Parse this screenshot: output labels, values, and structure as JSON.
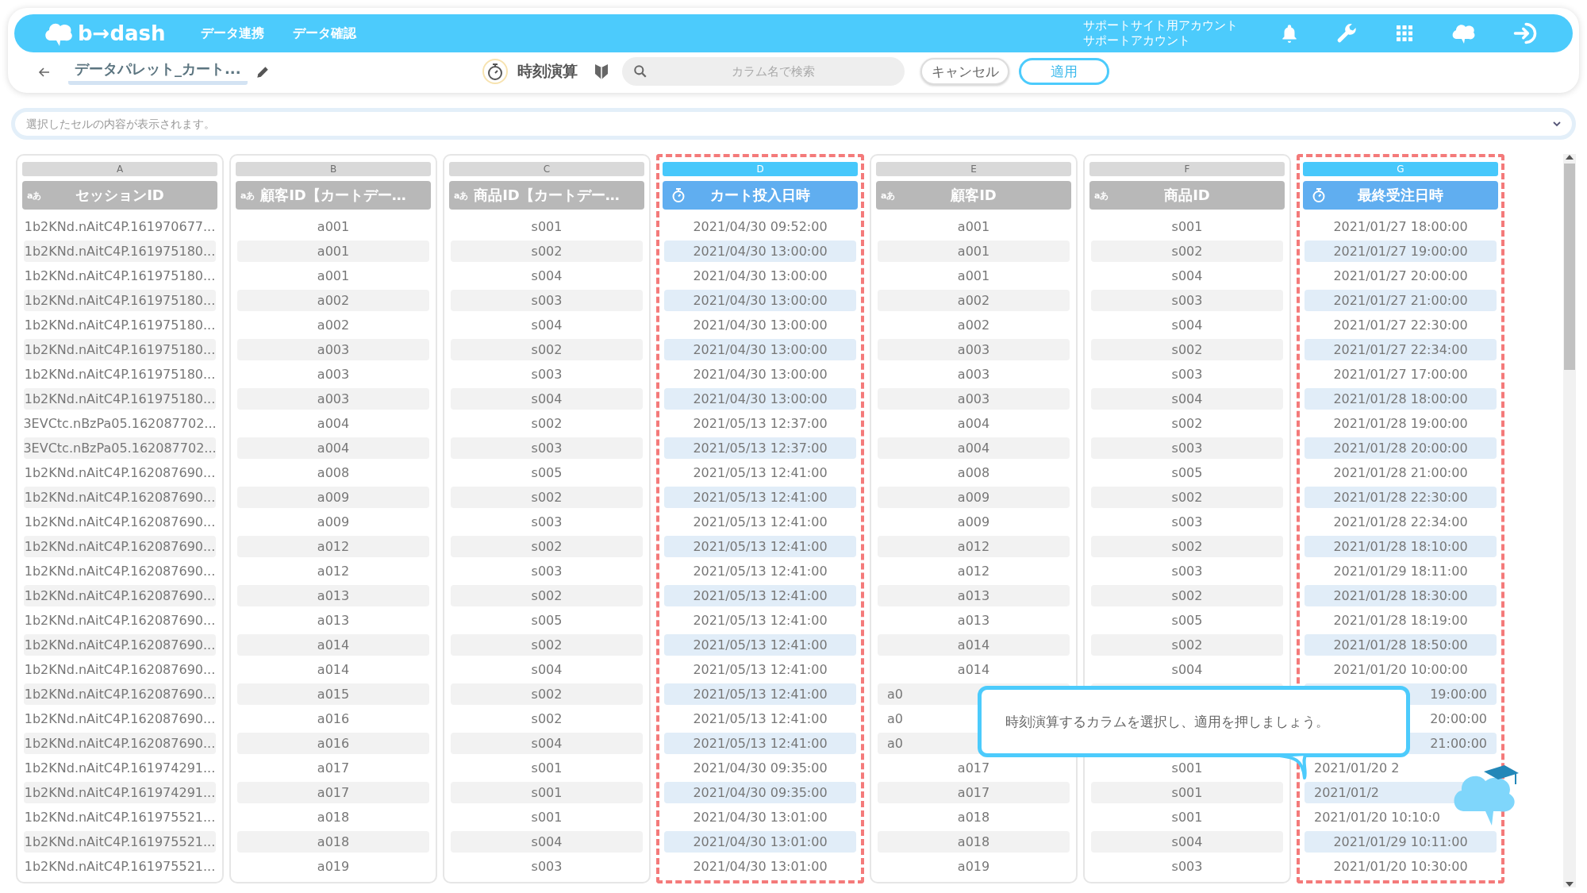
{
  "header": {
    "logo": "b→dash",
    "nav": [
      {
        "label": "データ連携"
      },
      {
        "label": "データ確認"
      }
    ],
    "account": [
      "サポートサイト用アカウント",
      "サポートアカウント"
    ]
  },
  "toolbar": {
    "title": "データパレット_カート...",
    "mode_label": "時刻演算",
    "search": {
      "placeholder": "カラム名で検索"
    },
    "buttons": [
      {
        "label": "キャンセル",
        "kind": "secondary"
      },
      {
        "label": "適用",
        "kind": "primary"
      }
    ]
  },
  "cell_viewer": {
    "placeholder": "選択したセルの内容が表示されます。"
  },
  "columns": [
    {
      "letter": "A",
      "name": "セッションID",
      "kind": "text",
      "type_label": "aあ",
      "selected": false
    },
    {
      "letter": "B",
      "name": "顧客ID【カートデー…",
      "kind": "text",
      "type_label": "aあ",
      "selected": false
    },
    {
      "letter": "C",
      "name": "商品ID【カートデー…",
      "kind": "text",
      "type_label": "aあ",
      "selected": false
    },
    {
      "letter": "D",
      "name": "カート投入日時",
      "kind": "time",
      "selected": true
    },
    {
      "letter": "E",
      "name": "顧客ID",
      "kind": "text",
      "type_label": "aあ",
      "selected": false
    },
    {
      "letter": "F",
      "name": "商品ID",
      "kind": "text",
      "type_label": "aあ",
      "selected": false
    },
    {
      "letter": "G",
      "name": "最終受注日時",
      "kind": "time",
      "selected": true
    }
  ],
  "rows": [
    [
      "1b2KNd.nAitC4P.161970677...",
      "a001",
      "s001",
      "2021/04/30 09:52:00",
      "a001",
      "s001",
      "2021/01/27 18:00:00"
    ],
    [
      "1b2KNd.nAitC4P.161975180...",
      "a001",
      "s002",
      "2021/04/30 13:00:00",
      "a001",
      "s002",
      "2021/01/27 19:00:00"
    ],
    [
      "1b2KNd.nAitC4P.161975180...",
      "a001",
      "s004",
      "2021/04/30 13:00:00",
      "a001",
      "s004",
      "2021/01/27 20:00:00"
    ],
    [
      "1b2KNd.nAitC4P.161975180...",
      "a002",
      "s003",
      "2021/04/30 13:00:00",
      "a002",
      "s003",
      "2021/01/27 21:00:00"
    ],
    [
      "1b2KNd.nAitC4P.161975180...",
      "a002",
      "s004",
      "2021/04/30 13:00:00",
      "a002",
      "s004",
      "2021/01/27 22:30:00"
    ],
    [
      "1b2KNd.nAitC4P.161975180...",
      "a003",
      "s002",
      "2021/04/30 13:00:00",
      "a003",
      "s002",
      "2021/01/27 22:34:00"
    ],
    [
      "1b2KNd.nAitC4P.161975180...",
      "a003",
      "s003",
      "2021/04/30 13:00:00",
      "a003",
      "s003",
      "2021/01/27 17:00:00"
    ],
    [
      "1b2KNd.nAitC4P.161975180...",
      "a003",
      "s004",
      "2021/04/30 13:00:00",
      "a003",
      "s004",
      "2021/01/28 18:00:00"
    ],
    [
      "3EVCtc.nBzPa05.162087702...",
      "a004",
      "s002",
      "2021/05/13 12:37:00",
      "a004",
      "s002",
      "2021/01/28 19:00:00"
    ],
    [
      "3EVCtc.nBzPa05.162087702...",
      "a004",
      "s003",
      "2021/05/13 12:37:00",
      "a004",
      "s003",
      "2021/01/28 20:00:00"
    ],
    [
      "1b2KNd.nAitC4P.162087690...",
      "a008",
      "s005",
      "2021/05/13 12:41:00",
      "a008",
      "s005",
      "2021/01/28 21:00:00"
    ],
    [
      "1b2KNd.nAitC4P.162087690...",
      "a009",
      "s002",
      "2021/05/13 12:41:00",
      "a009",
      "s002",
      "2021/01/28 22:30:00"
    ],
    [
      "1b2KNd.nAitC4P.162087690...",
      "a009",
      "s003",
      "2021/05/13 12:41:00",
      "a009",
      "s003",
      "2021/01/28 22:34:00"
    ],
    [
      "1b2KNd.nAitC4P.162087690...",
      "a012",
      "s002",
      "2021/05/13 12:41:00",
      "a012",
      "s002",
      "2021/01/28 18:10:00"
    ],
    [
      "1b2KNd.nAitC4P.162087690...",
      "a012",
      "s003",
      "2021/05/13 12:41:00",
      "a012",
      "s003",
      "2021/01/29 18:11:00"
    ],
    [
      "1b2KNd.nAitC4P.162087690...",
      "a013",
      "s002",
      "2021/05/13 12:41:00",
      "a013",
      "s002",
      "2021/01/28 18:30:00"
    ],
    [
      "1b2KNd.nAitC4P.162087690...",
      "a013",
      "s005",
      "2021/05/13 12:41:00",
      "a013",
      "s005",
      "2021/01/28 18:19:00"
    ],
    [
      "1b2KNd.nAitC4P.162087690...",
      "a014",
      "s002",
      "2021/05/13 12:41:00",
      "a014",
      "s002",
      "2021/01/28 18:50:00"
    ],
    [
      "1b2KNd.nAitC4P.162087690...",
      "a014",
      "s004",
      "2021/05/13 12:41:00",
      "a014",
      "s004",
      "2021/01/20 10:00:00"
    ],
    [
      "1b2KNd.nAitC4P.162087690...",
      "a015",
      "s002",
      "2021/05/13 12:41:00",
      {
        "text": "a0",
        "covered_right": true
      },
      null,
      {
        "text": "19:00:00",
        "covered_left": true
      }
    ],
    [
      "1b2KNd.nAitC4P.162087690...",
      "a016",
      "s002",
      "2021/05/13 12:41:00",
      {
        "text": "a0",
        "covered_right": true
      },
      null,
      {
        "text": "20:00:00",
        "covered_left": true
      }
    ],
    [
      "1b2KNd.nAitC4P.162087690...",
      "a016",
      "s004",
      "2021/05/13 12:41:00",
      {
        "text": "a0",
        "covered_right": true
      },
      null,
      {
        "text": "21:00:00",
        "covered_left": true
      }
    ],
    [
      "1b2KNd.nAitC4P.161974291...",
      "a017",
      "s001",
      "2021/04/30 09:35:00",
      "a017",
      "s001",
      {
        "text": "2021/01/20 2",
        "covered_right": true
      }
    ],
    [
      "1b2KNd.nAitC4P.161974291...",
      "a017",
      "s001",
      "2021/04/30 09:35:00",
      "a017",
      "s001",
      {
        "text": "2021/01/2",
        "covered_right": true
      }
    ],
    [
      "1b2KNd.nAitC4P.161975521...",
      "a018",
      "s001",
      "2021/04/30 13:01:00",
      "a018",
      "s001",
      {
        "text": "2021/01/20 10:10:0",
        "covered_right": true
      }
    ],
    [
      "1b2KNd.nAitC4P.161975521...",
      "a018",
      "s004",
      "2021/04/30 13:01:00",
      "a018",
      "s004",
      "2021/01/29 10:11:00"
    ],
    [
      "1b2KNd.nAitC4P.161975521...",
      "a019",
      "s003",
      "2021/04/30 13:01:00",
      "a019",
      "s003",
      "2021/01/20 10:30:00"
    ]
  ],
  "tooltip": {
    "text": "時刻演算するカラムを選択し、適用を押しましょう。"
  }
}
